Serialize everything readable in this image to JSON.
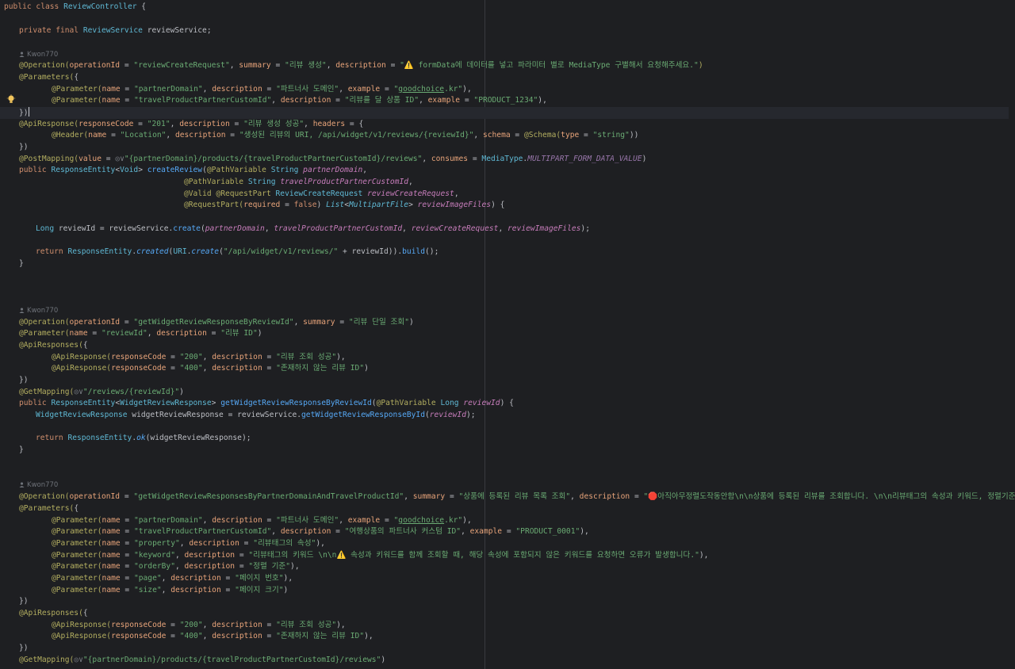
{
  "editor": {
    "language": "java",
    "author": "Kwon770",
    "icons": {
      "author": "person-icon",
      "bulb": "lightbulb-icon",
      "warn": "warning-icon",
      "stop": "stop-sign-icon",
      "globe": "globe-icon"
    },
    "colors": {
      "background": "#1e1f22",
      "keyword": "#cf8e6d",
      "class": "#5fb8d4",
      "annotation": "#b3ae60",
      "string": "#6aab73",
      "param": "#e8a47a"
    }
  },
  "code": {
    "class_decl": "public class ReviewController {",
    "field": "private final ReviewService reviewService;",
    "m1": {
      "op": "@Operation(operationId = \"reviewCreateRequest\", summary = \"리뷰 생성\", description = \"⚠️ formData에 데이터를 넣고 파라미터 별로 MediaType 구별해서 요청해주세요.\")",
      "params_open": "@Parameters({",
      "p1": "@Parameter(name = \"partnerDomain\", description = \"파트너사 도메인\", example = \"goodchoice.kr\"),",
      "p2": "@Parameter(name = \"travelProductPartnerCustomId\", description = \"리뷰를 달 상품 ID\", example = \"PRODUCT_1234\"),",
      "params_close": "})",
      "api": "@ApiResponse(responseCode = \"201\", description = \"리뷰 생성 성공\", headers = {",
      "header": "@Header(name = \"Location\", description = \"생성된 리뷰의 URI, /api/widget/v1/reviews/{reviewId}\", schema = @Schema(type = \"string\"))",
      "api_close": "})",
      "post": "@PostMapping(value = ◎∨\"{partnerDomain}/products/{travelProductPartnerCustomId}/reviews\", consumes = MediaType.MULTIPART_FORM_DATA_VALUE)",
      "sig1": "public ResponseEntity<Void> createReview(@PathVariable String partnerDomain,",
      "sig2": "@PathVariable String travelProductPartnerCustomId,",
      "sig3": "@Valid @RequestPart ReviewCreateRequest reviewCreateRequest,",
      "sig4": "@RequestPart(required = false) List<MultipartFile> reviewImageFiles) {",
      "body1": "Long reviewId = reviewService.create(partnerDomain, travelProductPartnerCustomId, reviewCreateRequest, reviewImageFiles);",
      "body2": "return ResponseEntity.created(URI.create(\"/api/widget/v1/reviews/\" + reviewId)).build();",
      "close": "}"
    },
    "m2": {
      "op": "@Operation(operationId = \"getWidgetReviewResponseByReviewId\", summary = \"리뷰 단일 조회\")",
      "param": "@Parameter(name = \"reviewId\", description = \"리뷰 ID\")",
      "apis_open": "@ApiResponses({",
      "a1": "@ApiResponse(responseCode = \"200\", description = \"리뷰 조회 성공\"),",
      "a2": "@ApiResponse(responseCode = \"400\", description = \"존재하지 않는 리뷰 ID\")",
      "apis_close": "})",
      "get": "@GetMapping(◎∨\"/reviews/{reviewId}\")",
      "sig": "public ResponseEntity<WidgetReviewResponse> getWidgetReviewResponseByReviewId(@PathVariable Long reviewId) {",
      "body1": "WidgetReviewResponse widgetReviewResponse = reviewService.getWidgetReviewResponseById(reviewId);",
      "body2": "return ResponseEntity.ok(widgetReviewResponse);",
      "close": "}"
    },
    "m3": {
      "op": "@Operation(operationId = \"getWidgetReviewResponsesByPartnerDomainAndTravelProductId\", summary = \"상품에 등록된 리뷰 목록 조회\", description = \"🛑아직아무정렬도작동안함\\n\\n상품에 등록된 리뷰를 조회합니다. \\n\\n리뷰태그의 속성과 키워드, 정렬기준, 페이징를 조회 옵션에 적용할 수 있습니다.\")",
      "params_open": "@Parameters({",
      "p1": "@Parameter(name = \"partnerDomain\", description = \"파트너사 도메인\", example = \"goodchoice.kr\"),",
      "p2": "@Parameter(name = \"travelProductPartnerCustomId\", description = \"여행상품의 파트너사 커스텀 ID\", example = \"PRODUCT_0001\"),",
      "p3": "@Parameter(name = \"property\", description = \"리뷰태그의 속성\"),",
      "p4": "@Parameter(name = \"keyword\", description = \"리뷰태그의 키워드 \\n\\n⚠️ 속성과 키워드를 함께 조회할 때, 해당 속성에 포함되지 않은 키워드를 요청하면 오류가 발생합니다.\"),",
      "p5": "@Parameter(name = \"orderBy\", description = \"정렬 기준\"),",
      "p6": "@Parameter(name = \"page\", description = \"페이지 번호\"),",
      "p7": "@Parameter(name = \"size\", description = \"페이지 크기\")",
      "params_close": "})",
      "apis_open": "@ApiResponses({",
      "a1": "@ApiResponse(responseCode = \"200\", description = \"리뷰 조회 성공\"),",
      "a2": "@ApiResponse(responseCode = \"400\", description = \"존재하지 않는 리뷰 ID\"),",
      "apis_close": "})",
      "get": "@GetMapping(◎∨\"{partnerDomain}/products/{travelProductPartnerCustomId}/reviews\")"
    }
  }
}
